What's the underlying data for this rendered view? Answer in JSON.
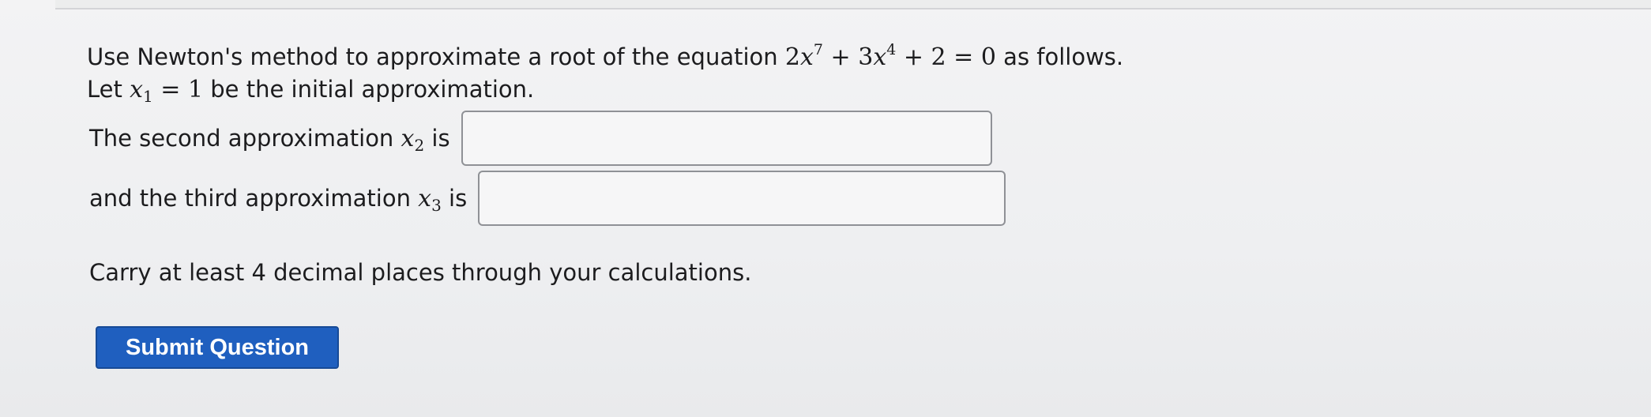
{
  "question": {
    "intro": "Use Newton's method to approximate a root of the equation",
    "equation": {
      "c1": "2",
      "v1": "x",
      "e1": "7",
      "plus1": " + ",
      "c2": "3",
      "v2": "x",
      "e2": "4",
      "plus2": " + ",
      "c3": "2",
      "eq": " = ",
      "rhs": "0"
    },
    "intro_end": "as follows.",
    "let_prefix": "Let",
    "initial": {
      "var": "x",
      "sub": "1",
      "eq": " = ",
      "value": "1"
    },
    "let_suffix": "be the initial approximation."
  },
  "answers": {
    "second_label": "The second approximation",
    "second_var": "x",
    "second_sub": "2",
    "second_is": "is",
    "second_value": "",
    "third_label": "and the third approximation",
    "third_var": "x",
    "third_sub": "3",
    "third_is": "is",
    "third_value": ""
  },
  "note": "Carry at least 4 decimal places through your calculations.",
  "submit_label": "Submit Question",
  "colors": {
    "submit_bg": "#1f5fbf",
    "submit_text": "#ffffff"
  }
}
